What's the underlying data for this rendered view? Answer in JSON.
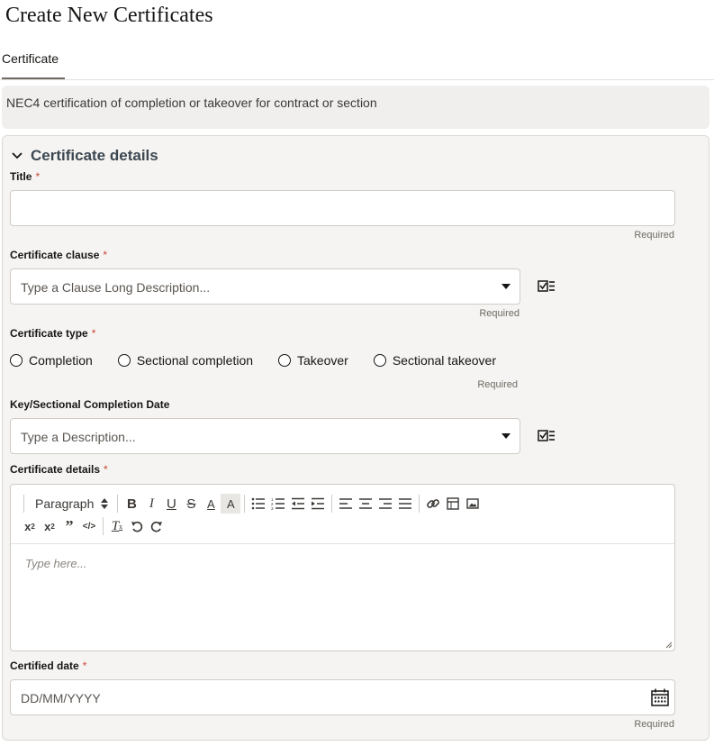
{
  "page": {
    "title": "Create New Certificates"
  },
  "tabs": [
    {
      "label": "Certificate"
    }
  ],
  "info": {
    "text": "NEC4 certification of completion or takeover for contract or section"
  },
  "section": {
    "title": "Certificate details",
    "fields": {
      "title": {
        "label": "Title",
        "star": "*",
        "value": "",
        "required_note": "Required"
      },
      "clause": {
        "label": "Certificate clause",
        "star": "*",
        "placeholder": "Type a Clause Long Description...",
        "required_note": "Required"
      },
      "type": {
        "label": "Certificate type",
        "star": "*",
        "options": [
          "Completion",
          "Sectional completion",
          "Takeover",
          "Sectional takeover"
        ],
        "required_note": "Required"
      },
      "key_date": {
        "label": "Key/Sectional Completion Date",
        "placeholder": "Type a Description..."
      },
      "details": {
        "label": "Certificate details",
        "star": "*",
        "paragraph_select": "Paragraph",
        "placeholder": "Type here..."
      },
      "certified_date": {
        "label": "Certified date",
        "star": "*",
        "placeholder": "DD/MM/YYYY",
        "required_note": "Required"
      }
    }
  },
  "colors": {
    "required_star": "#c74634",
    "section_title": "#3c4751",
    "section_bg": "#f5f4f2"
  },
  "icons": [
    "chevron-down-icon",
    "list-select-icon",
    "calendar-icon"
  ]
}
